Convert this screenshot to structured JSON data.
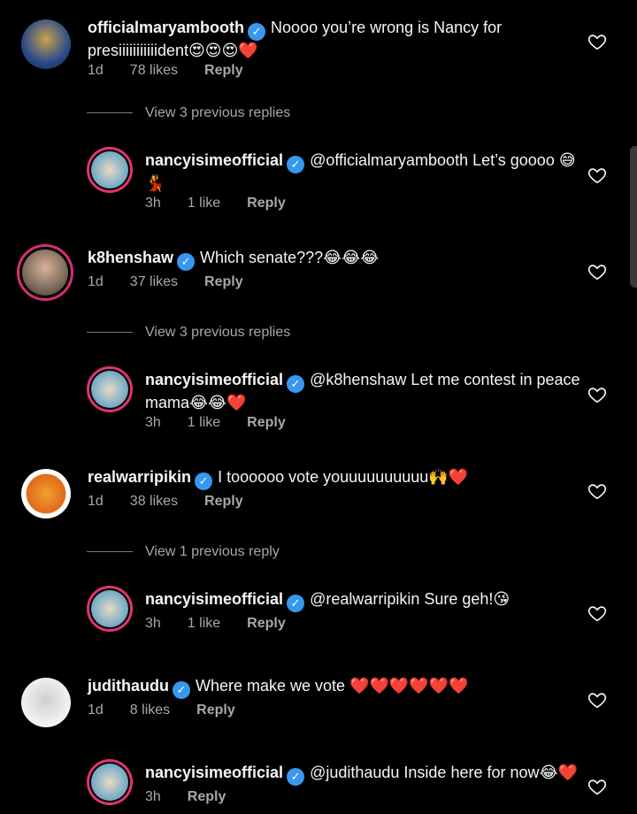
{
  "comments": [
    {
      "user": "officialmaryambooth",
      "text": "Noooo you’re wrong is Nancy for presiiiiiiiiiiident😍😍😍❤️",
      "time": "1d",
      "likes": "78 likes",
      "reply": "Reply",
      "view_replies": "View 3 previous replies",
      "reply_item": {
        "user": "nancyisimeofficial",
        "text": "@officialmaryambooth Let’s goooo 😅💃",
        "time": "3h",
        "likes": "1 like",
        "reply": "Reply"
      }
    },
    {
      "user": "k8henshaw",
      "text": "Which senate???😂😂😂",
      "time": "1d",
      "likes": "37 likes",
      "reply": "Reply",
      "view_replies": "View 3 previous replies",
      "reply_item": {
        "user": "nancyisimeofficial",
        "text": "@k8henshaw Let me contest in peace mama😂😂❤️",
        "time": "3h",
        "likes": "1 like",
        "reply": "Reply"
      }
    },
    {
      "user": "realwarripikin",
      "text": "I toooooo vote youuuuuuuuuu🙌❤️",
      "time": "1d",
      "likes": "38 likes",
      "reply": "Reply",
      "view_replies": "View 1 previous reply",
      "reply_item": {
        "user": "nancyisimeofficial",
        "text": "@realwarripikin Sure geh!😘",
        "time": "3h",
        "likes": "1 like",
        "reply": "Reply"
      }
    },
    {
      "user": "judithaudu",
      "text": "Where make we vote ❤️❤️❤️❤️❤️❤️",
      "time": "1d",
      "likes": "8 likes",
      "reply": "Reply",
      "reply_item": {
        "user": "nancyisimeofficial",
        "text": "@judithaudu Inside here for now😂❤️",
        "time": "3h",
        "likes": "",
        "reply": "Reply"
      }
    }
  ],
  "icons": {
    "verified": "verified-badge-icon",
    "like": "heart-icon"
  },
  "colors": {
    "background": "#000000",
    "verified": "#3897f0",
    "story_ring": "#d62f6f"
  }
}
